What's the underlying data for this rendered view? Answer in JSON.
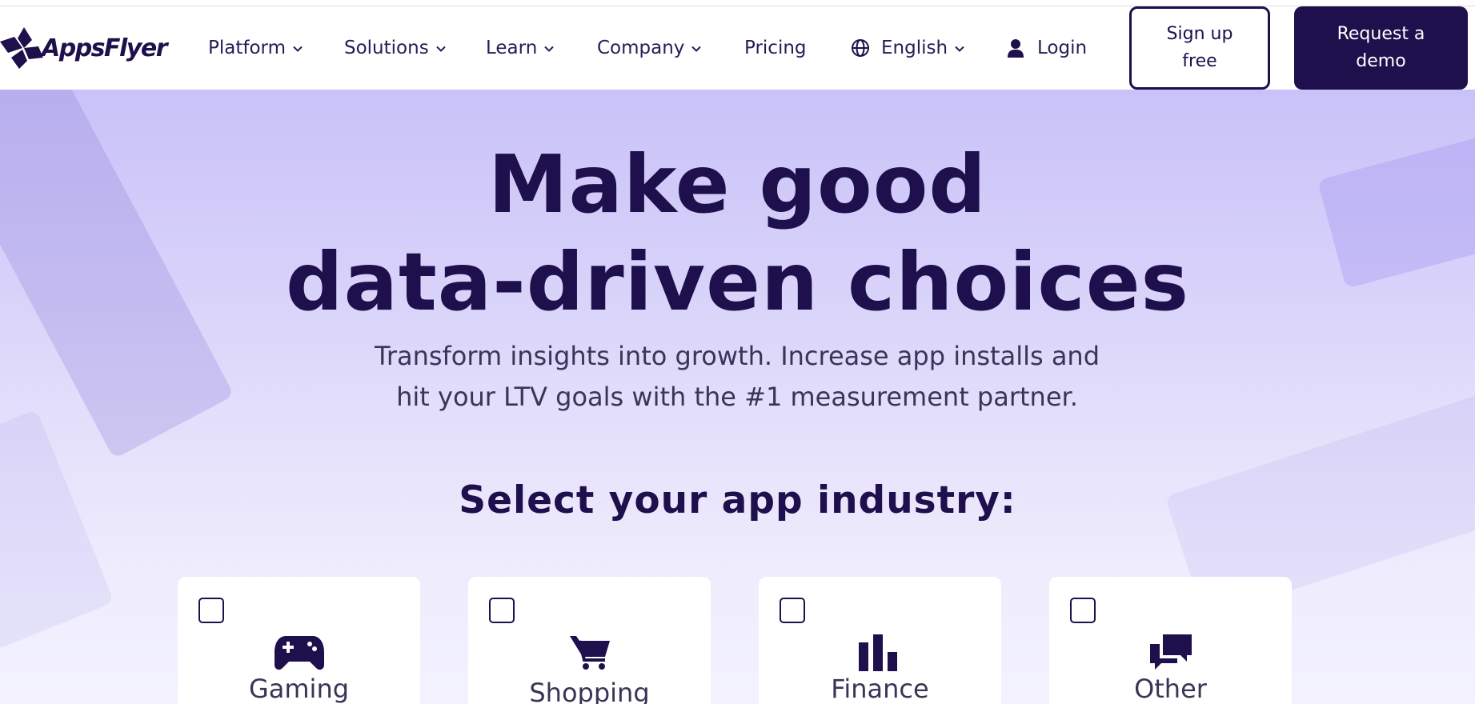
{
  "brand": {
    "name": "AppsFlyer"
  },
  "nav": {
    "items": [
      {
        "label": "Platform",
        "has_dropdown": true
      },
      {
        "label": "Solutions",
        "has_dropdown": true
      },
      {
        "label": "Learn",
        "has_dropdown": true
      },
      {
        "label": "Company",
        "has_dropdown": true
      },
      {
        "label": "Pricing",
        "has_dropdown": false
      }
    ],
    "language": {
      "label": "English",
      "icon": "globe-icon"
    },
    "login": {
      "label": "Login",
      "icon": "user-icon"
    },
    "signup_label": "Sign up free",
    "demo_label": "Request a demo"
  },
  "hero": {
    "headline_line1": "Make good",
    "headline_line2": "data-driven choices",
    "subhead_line1": "Transform insights into growth. Increase app installs and",
    "subhead_line2": "hit your LTV goals with the #1 measurement partner.",
    "select_title": "Select your app industry:"
  },
  "industries": [
    {
      "label": "Gaming",
      "icon": "gamepad-icon",
      "checked": false
    },
    {
      "label": "Shopping",
      "icon": "shopping-cart-icon",
      "checked": false
    },
    {
      "label": "Finance",
      "icon": "bar-chart-icon",
      "checked": false
    },
    {
      "label": "Other",
      "icon": "chat-bubbles-icon",
      "checked": false
    }
  ],
  "colors": {
    "brand_dark": "#1e0f4d",
    "hero_top": "#c9c2f8",
    "hero_bottom": "#f3f2fe",
    "text_muted": "#3b3456"
  }
}
